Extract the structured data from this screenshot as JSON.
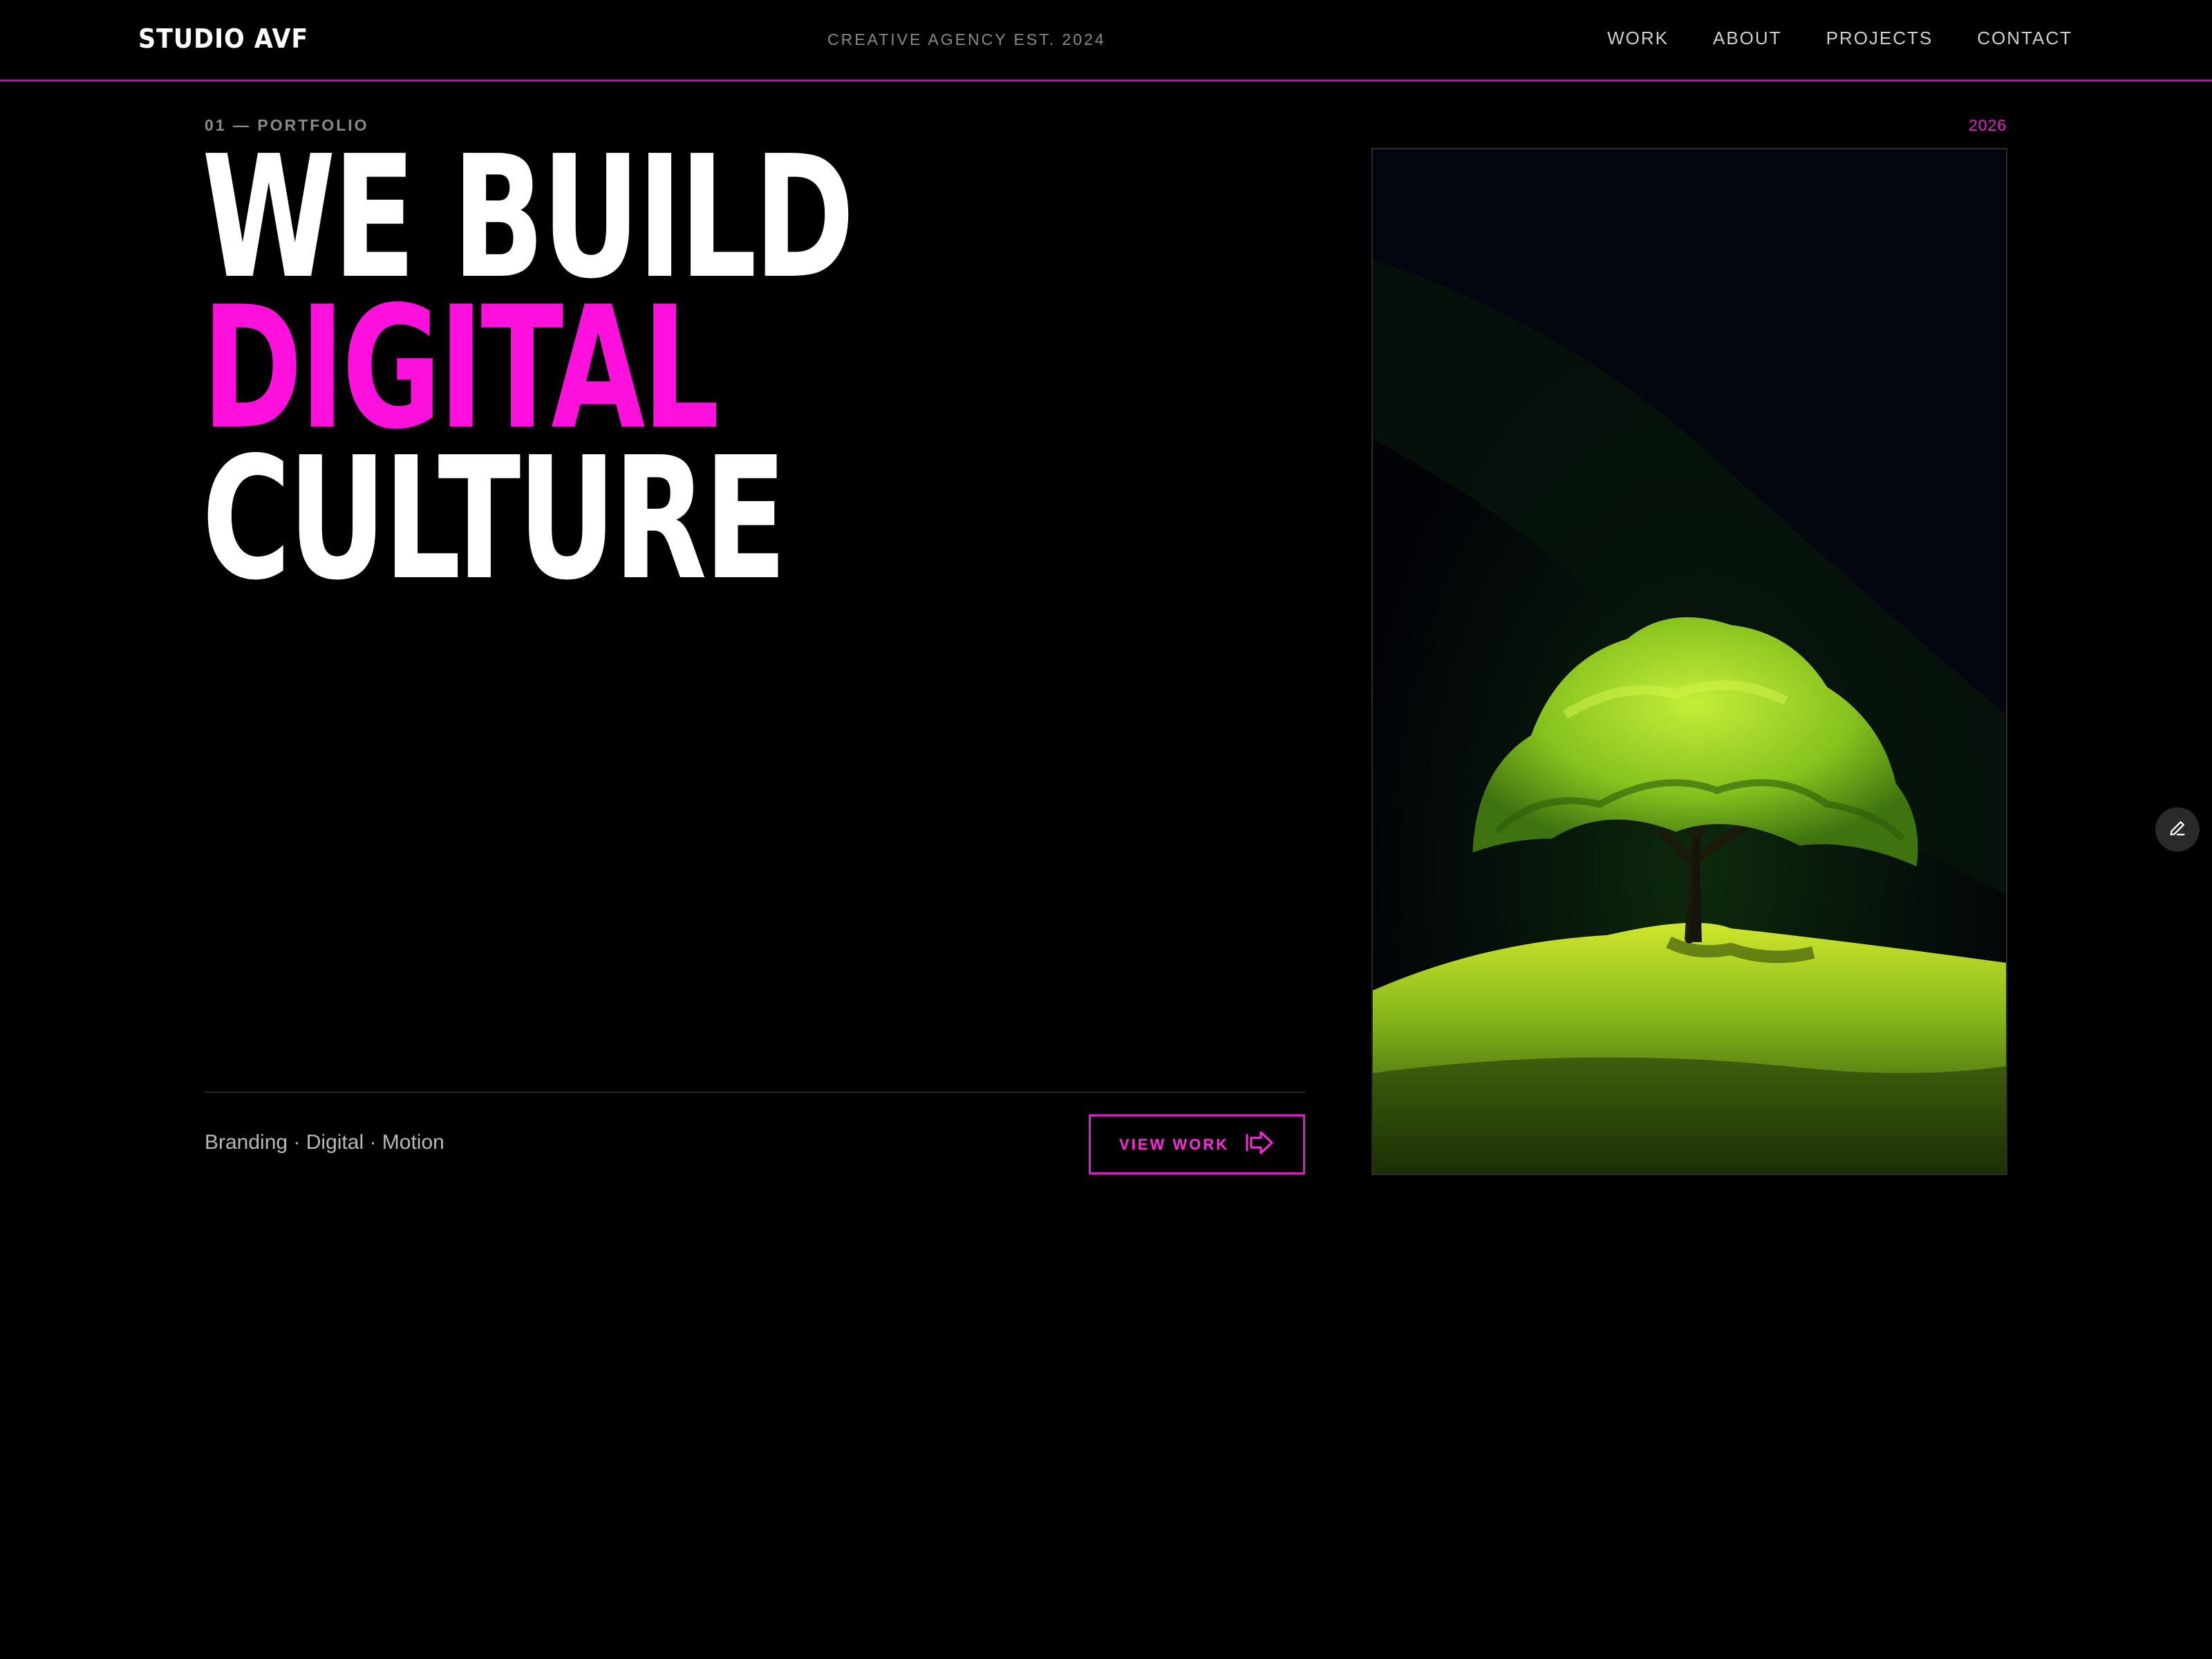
{
  "header": {
    "logo": "STUDIO AVF",
    "tagline": "CREATIVE AGENCY EST. 2024",
    "nav": [
      "WORK",
      "ABOUT",
      "PROJECTS",
      "CONTACT"
    ]
  },
  "hero": {
    "eyebrow": "01 — PORTFOLIO",
    "year": "2026",
    "headline": [
      "WE BUILD",
      "DIGITAL",
      "CULTURE"
    ],
    "services": "Branding · Digital · Motion",
    "cta_label": "VIEW WORK",
    "cta_icon": "arrow-right-icon"
  },
  "image": {
    "subject": "lone-green-tree-on-hill-icon"
  },
  "floating": {
    "edit_icon": "pencil-icon"
  },
  "colors": {
    "background": "#000000",
    "accent": "#ff10dc",
    "text": "#ffffff",
    "muted": "#8a8a8a",
    "image_green": "#a8d820"
  }
}
